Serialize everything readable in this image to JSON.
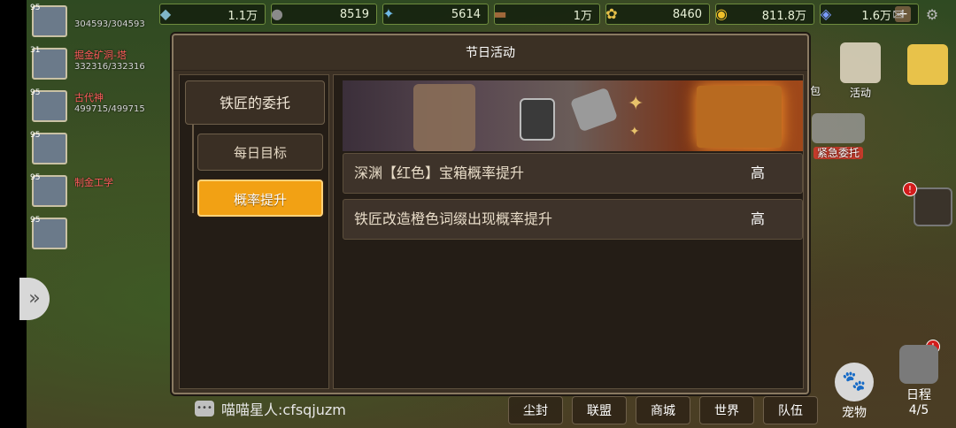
{
  "resources": [
    {
      "icon": "stone-icon",
      "glyph": "◆",
      "color": "#7fb6c8",
      "value": "1.1万"
    },
    {
      "icon": "ore-icon",
      "glyph": "●",
      "color": "#8a8a8a",
      "value": "8519"
    },
    {
      "icon": "crystal-icon",
      "glyph": "✦",
      "color": "#6fb9e6",
      "value": "5614"
    },
    {
      "icon": "wood-icon",
      "glyph": "▬",
      "color": "#a0683a",
      "value": "1万"
    },
    {
      "icon": "wheat-icon",
      "glyph": "✿",
      "color": "#e6c04a",
      "value": "8460"
    },
    {
      "icon": "gold-icon",
      "glyph": "◉",
      "color": "#f0c02a",
      "value": "811.8万"
    },
    {
      "icon": "diamond-icon",
      "glyph": "◈",
      "color": "#7a9cff",
      "value": "1.6万"
    }
  ],
  "party": [
    {
      "level": "95",
      "name": "",
      "hp": "304593/304593"
    },
    {
      "level": "31",
      "name": "掘金矿洞-塔",
      "hp": "332316/332316"
    },
    {
      "level": "95",
      "name": "古代神",
      "hp": "499715/499715"
    },
    {
      "level": "95",
      "name": "",
      "hp": ""
    },
    {
      "level": "95",
      "name": "制金工学",
      "hp": ""
    },
    {
      "level": "95",
      "name": "",
      "hp": ""
    }
  ],
  "right_icons": {
    "activity": "活动",
    "bag": "包",
    "urgent": "紧急委托"
  },
  "modal": {
    "title": "节日活动",
    "main_tab": "铁匠的委托",
    "sub_tabs": [
      "每日目标",
      "概率提升"
    ],
    "active_sub_tab": 1,
    "rows": [
      {
        "label": "深渊【红色】宝箱概率提升",
        "value": "高"
      },
      {
        "label": "铁匠改造橙色词缀出现概率提升",
        "value": "高"
      }
    ]
  },
  "chat": {
    "message": "喵喵星人:cfsqjuzm"
  },
  "bottom_menu": [
    "尘封",
    "联盟",
    "商城",
    "世界",
    "队伍"
  ],
  "pet_label": "宠物",
  "schedule": {
    "label": "日程",
    "count": "4/5"
  }
}
